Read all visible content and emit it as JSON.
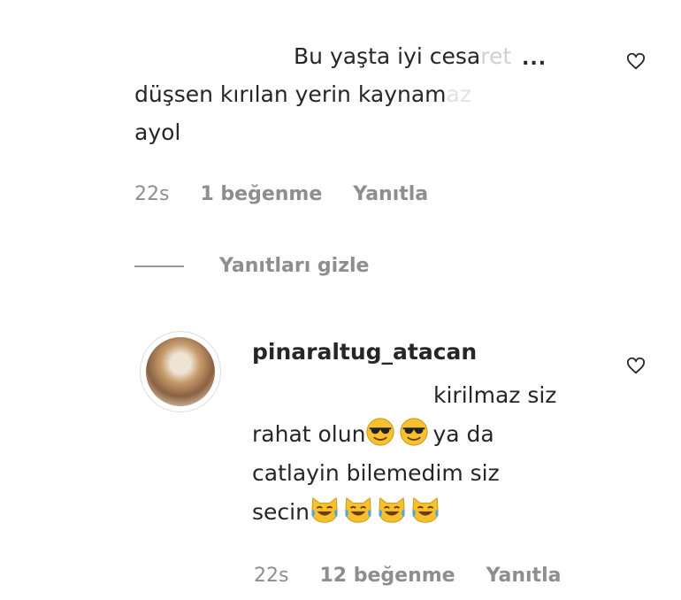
{
  "comment1": {
    "line1": "Bu yaşta iyi cesa",
    "line1_faded": "ret",
    "line2": "düşsen kırılan yerin kaynam",
    "line2_faded": "az",
    "line3": "ayol",
    "more": "...",
    "time": "22s",
    "likes": "1 beğenme",
    "reply": "Yanıtla"
  },
  "hide_replies": "Yanıtları gizle",
  "reply1": {
    "username": "pinaraltug_atacan",
    "line1": "kirilmaz siz",
    "line2a": "rahat olun",
    "line2b": "ya da",
    "line3": "catlayin bilemedim siz",
    "line4": "secin",
    "time": "22s",
    "likes": "12 beğenme",
    "reply": "Yanıtla",
    "emojis_line2": [
      "sunglasses-face",
      "sunglasses-face"
    ],
    "emojis_line4": [
      "cat-tears-of-joy",
      "cat-tears-of-joy",
      "cat-tears-of-joy",
      "cat-tears-of-joy"
    ]
  },
  "colors": {
    "text": "#262626",
    "secondary": "#8e8e8e",
    "emoji_yellow": "#f7c12d",
    "emoji_tear": "#4aa7e8"
  }
}
